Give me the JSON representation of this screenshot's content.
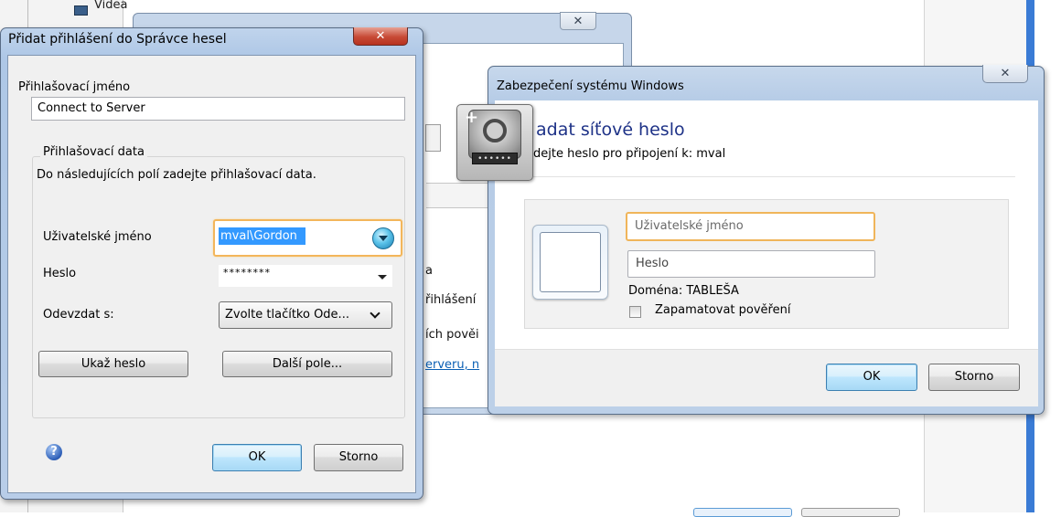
{
  "background": {
    "explorer_item": "Videa",
    "mid_window": {
      "close_glyph": "✕",
      "fragment_a": "a",
      "fragment_login": "řihlášení",
      "fragment_cred": "ích pověi",
      "fragment_link": "erveru, n"
    }
  },
  "left_dialog": {
    "title": "Přidat přihlášení do Správce hesel",
    "close_glyph": "✕",
    "login_name_label": "Přihlašovací jméno",
    "login_name_value": "Connect to Server",
    "group_legend": "Přihlašovací data",
    "group_hint": "Do následujících polí zadejte přihlašovací data.",
    "username_label": "Uživatelské jméno",
    "username_value": "mval\\Gordon",
    "password_label": "Heslo",
    "password_value": "********",
    "submit_label": "Odevzdat s:",
    "submit_value": "Zvolte tlačítko Ode...",
    "show_password_button": "Ukaž heslo",
    "more_fields_button": "Další pole...",
    "help_glyph": "?",
    "ok_button": "OK",
    "cancel_button": "Storno"
  },
  "right_dialog": {
    "title": "Zabezpečení systému Windows",
    "close_glyph": "✕",
    "heading": "adat síťové heslo",
    "subheading": "dejte heslo pro připojení k: mval",
    "username_placeholder": "Uživatelské jméno",
    "password_placeholder": "Heslo",
    "domain_text": "Doména: TABLEŠA",
    "remember_label": "Zapamatovat pověření",
    "remember_checked": false,
    "ok_button": "OK",
    "cancel_button": "Storno"
  },
  "overlay_icon": {
    "plus": "+",
    "dots": "••••••"
  },
  "colors": {
    "focus_border": "#f0b55a",
    "selection": "#3399ff",
    "heading_blue": "#1e3287",
    "close_red": "#c74a36",
    "taskbar_blue": "#3a7bd5"
  }
}
